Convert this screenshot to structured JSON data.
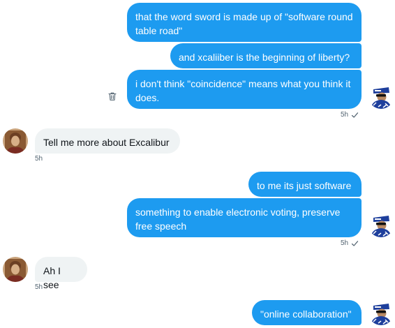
{
  "messages": [
    {
      "id": "m1",
      "text": "that the word sword is made up of \"software round table road\""
    },
    {
      "id": "m2",
      "text": "and xcaliiber is the beginning of liberty?"
    },
    {
      "id": "m3",
      "text": "i don't think \"coincidence\" means what you think it does."
    },
    {
      "id": "m4",
      "text": "Tell me more about Excalibur"
    },
    {
      "id": "m5",
      "text": "to me its just software"
    },
    {
      "id": "m6",
      "text": "something to enable electronic voting, preserve free speech"
    },
    {
      "id": "m7",
      "text": "Ah I see"
    },
    {
      "id": "m8",
      "text": "\"online collaboration\""
    }
  ],
  "timestamps": {
    "t1": "5h",
    "t2": "5h",
    "t3": "5h",
    "t4": "5h"
  },
  "icons": {
    "delete": "trash-icon",
    "read": "checkmark-icon"
  },
  "colors": {
    "outgoing": "#1d9bf0",
    "incoming": "#eff3f4",
    "meta": "#536471"
  }
}
